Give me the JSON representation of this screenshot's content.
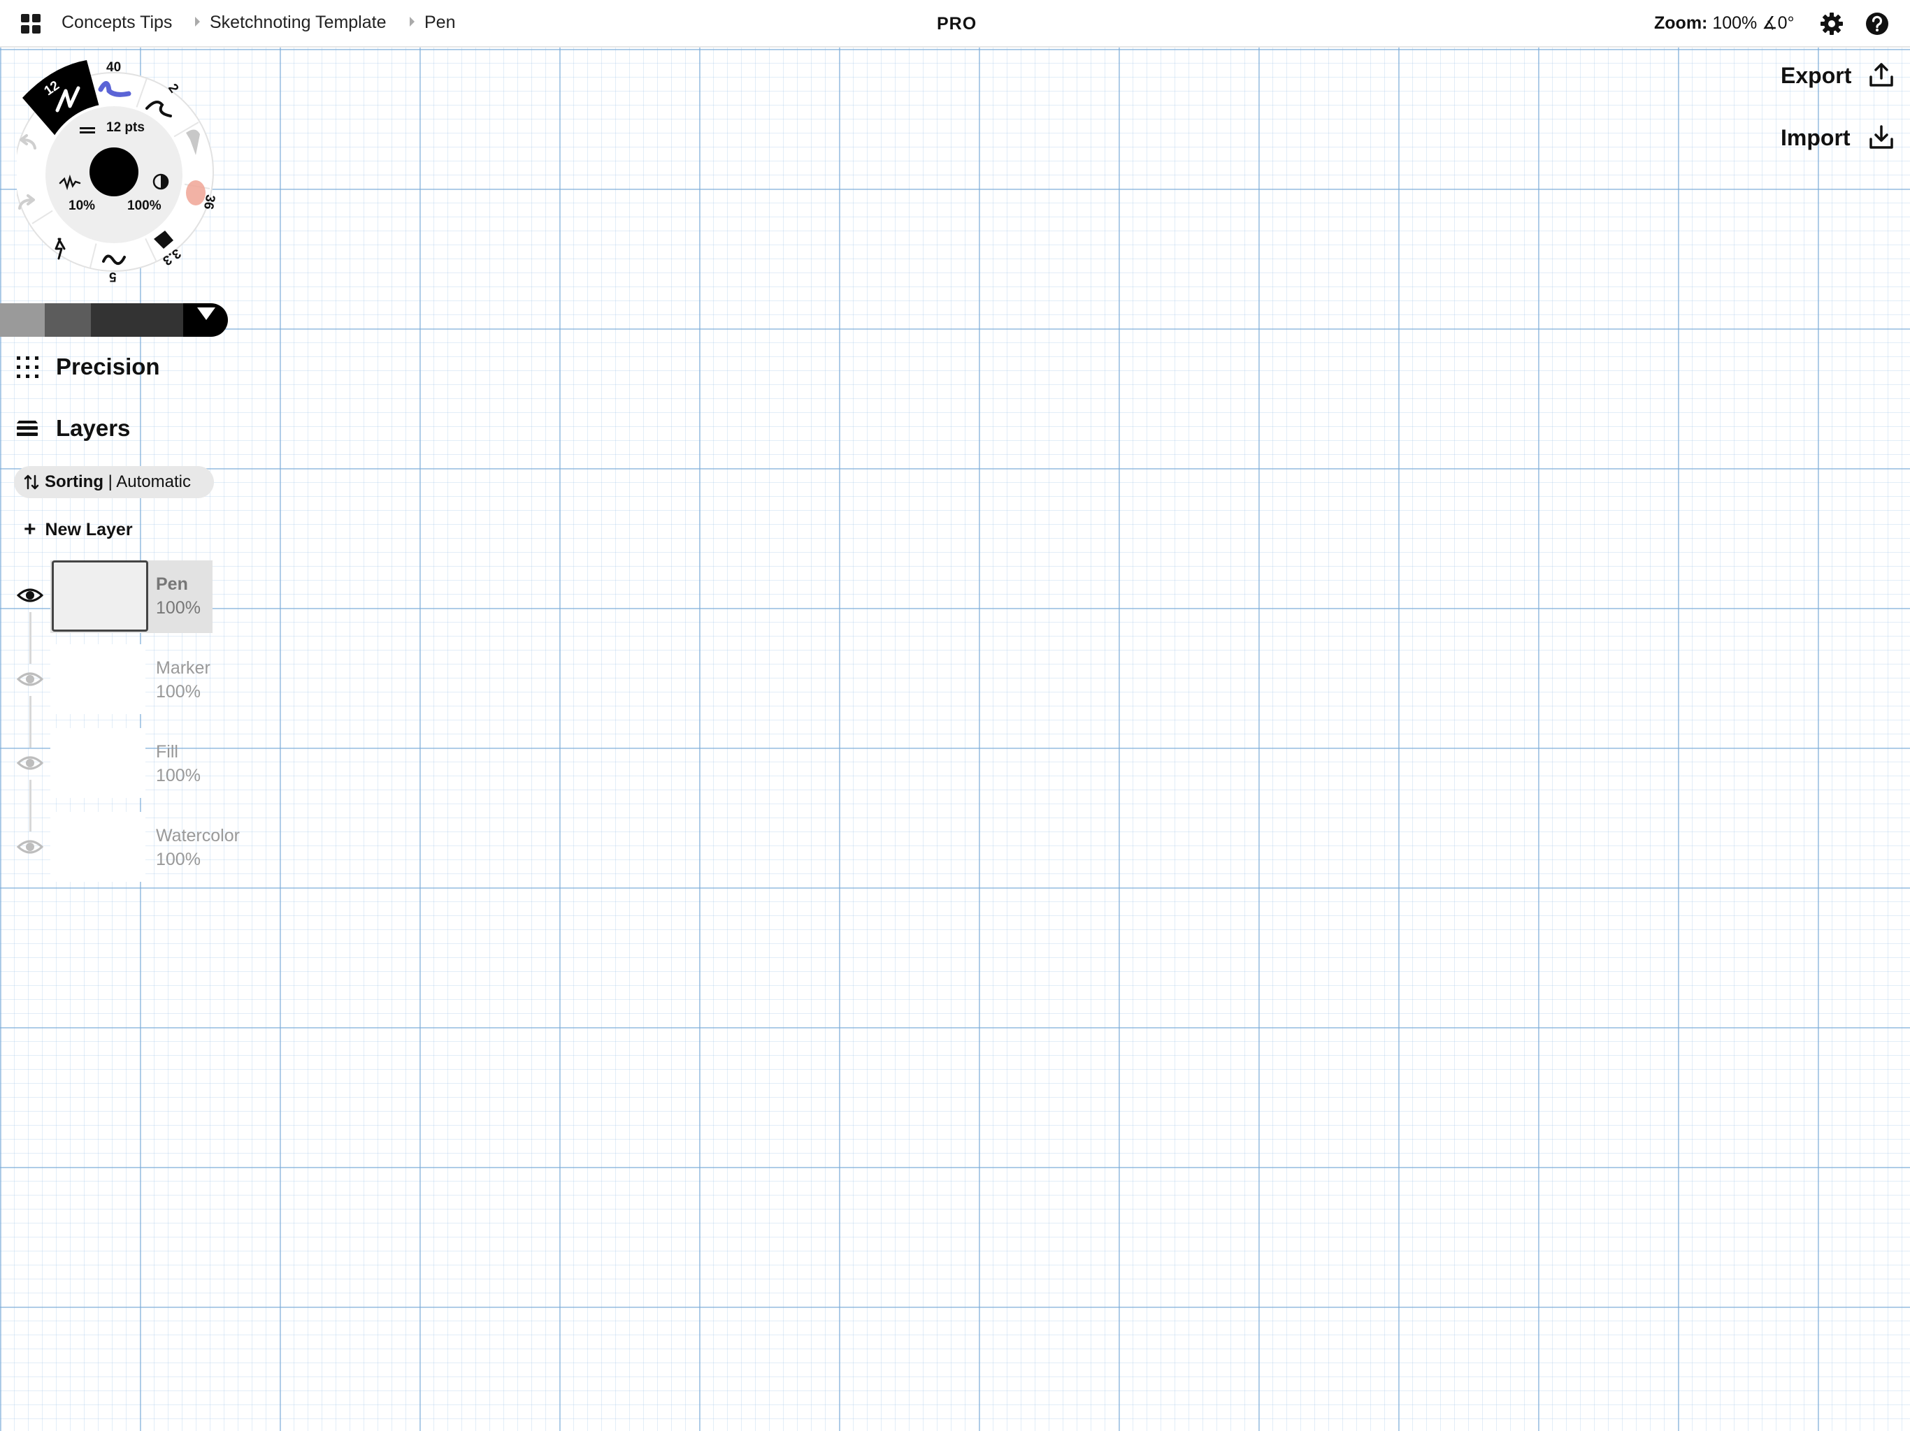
{
  "topbar": {
    "breadcrumbs": [
      "Concepts Tips",
      "Sketchnoting Template",
      "Pen"
    ],
    "badge": "PRO",
    "zoom_label": "Zoom:",
    "zoom_value": "100%",
    "angle_value": "∡0°"
  },
  "actions": {
    "export_label": "Export",
    "import_label": "Import"
  },
  "tool_wheel": {
    "active_tool_size": "12",
    "size_labels": [
      "40",
      "2",
      "36",
      "3.3",
      "5"
    ],
    "stroke_size": "12 pts",
    "smoothing": "10%",
    "opacity": "100%",
    "current_color": "#000000",
    "ink_color": "#5b64d6",
    "watercolor_color": "#f0a595"
  },
  "palette": {
    "swatches": [
      "#9a9a9a",
      "#5c5c5c",
      "#333333",
      "#333333",
      "#000000"
    ]
  },
  "panels": {
    "precision_label": "Precision",
    "layers_label": "Layers"
  },
  "sorting": {
    "label": "Sorting",
    "separator": "|",
    "value": "Automatic"
  },
  "new_layer_label": "New Layer",
  "layers": [
    {
      "name": "Pen",
      "opacity": "100%",
      "active": true
    },
    {
      "name": "Marker",
      "opacity": "100%",
      "active": false
    },
    {
      "name": "Fill",
      "opacity": "100%",
      "active": false
    },
    {
      "name": "Watercolor",
      "opacity": "100%",
      "active": false
    }
  ]
}
